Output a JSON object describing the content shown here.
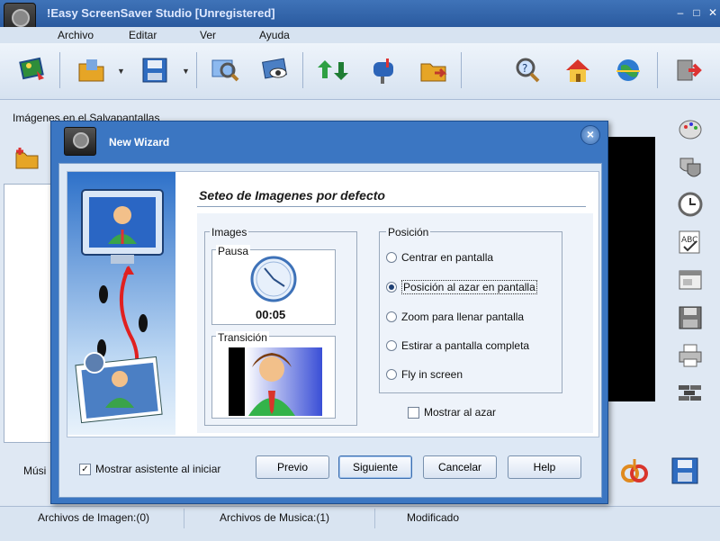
{
  "window": {
    "title": "!Easy ScreenSaver Studio [Unregistered]",
    "controls": [
      "–",
      "□",
      "✕"
    ]
  },
  "menu": [
    "Archivo",
    "Editar",
    "Ver",
    "Ayuda"
  ],
  "toolbar_icons": [
    "image-add-icon",
    "open-folder-icon",
    "save-icon",
    "preview-search-icon",
    "screen-eye-icon",
    "recycle-icon",
    "mailbox-icon",
    "folder-export-icon",
    "help-search-icon",
    "home-icon",
    "globe-icon",
    "exit-icon"
  ],
  "main": {
    "section_label": "Imágenes en el Salvapantallas",
    "music_label": "Músi"
  },
  "side_icons": [
    "palette-icon",
    "theater-masks-icon",
    "clock-icon",
    "spellcheck-icon",
    "window-icon",
    "disk-icon",
    "printer-icon",
    "wall-icon"
  ],
  "status": {
    "images": "Archivos de Imagen:(0)",
    "music": "Archivos de Musica:(1)",
    "modified": "Modificado"
  },
  "wizard": {
    "title": "New Wizard",
    "heading": "Seteo de Imagenes por defecto",
    "images_group": "Images",
    "pausa_label": "Pausa",
    "pausa_time": "00:05",
    "transicion_label": "Transición",
    "posicion_group": "Posición",
    "options": [
      {
        "label": "Centrar en pantalla",
        "selected": false
      },
      {
        "label": "Posición al azar en pantalla",
        "selected": true
      },
      {
        "label": "Zoom para llenar pantalla",
        "selected": false
      },
      {
        "label": "Estirar a pantalla completa",
        "selected": false
      },
      {
        "label": "Fly in screen",
        "selected": false
      }
    ],
    "mostrar_azar": "Mostrar al azar",
    "mostrar_asistente": "Mostrar asistente al iniciar",
    "buttons": {
      "previo": "Previo",
      "siguiente": "Siguiente",
      "cancelar": "Cancelar",
      "ayuda": "Help"
    }
  }
}
